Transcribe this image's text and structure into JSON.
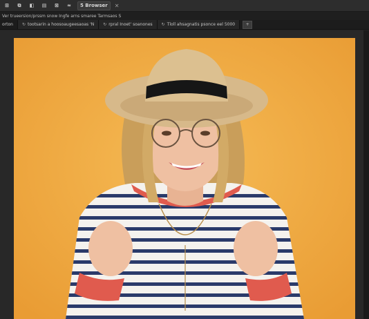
{
  "toolbar": {
    "buttons": [
      "⊞",
      "⧉",
      "◧",
      "▤",
      "⊠",
      "≈"
    ],
    "active_label": "5 Browser",
    "close_symbol": "✕"
  },
  "info": {
    "text": "Ver trueersion/prssm snow Ingfe arns smaree Tarmsaos S"
  },
  "tabs": {
    "first_label": "orton",
    "items": [
      {
        "label": "tootsarin a hoosoaugeesaoas 'N",
        "icon": "↻"
      },
      {
        "label": "rpral Inoet' soanones",
        "icon": "↻"
      },
      {
        "label": "Tloll ahsagnatis psonce eel 5000",
        "icon": "↻"
      }
    ],
    "add_label": "+"
  },
  "colors": {
    "background": "#f3b34a",
    "hat": "#d7b98a",
    "hat_band": "#161616",
    "stripe_dark": "#2a3a6a",
    "stripe_light": "#f4f2ee",
    "cuff": "#e05b4e",
    "hair": "#c99e5a",
    "skin": "#efc0a2"
  }
}
